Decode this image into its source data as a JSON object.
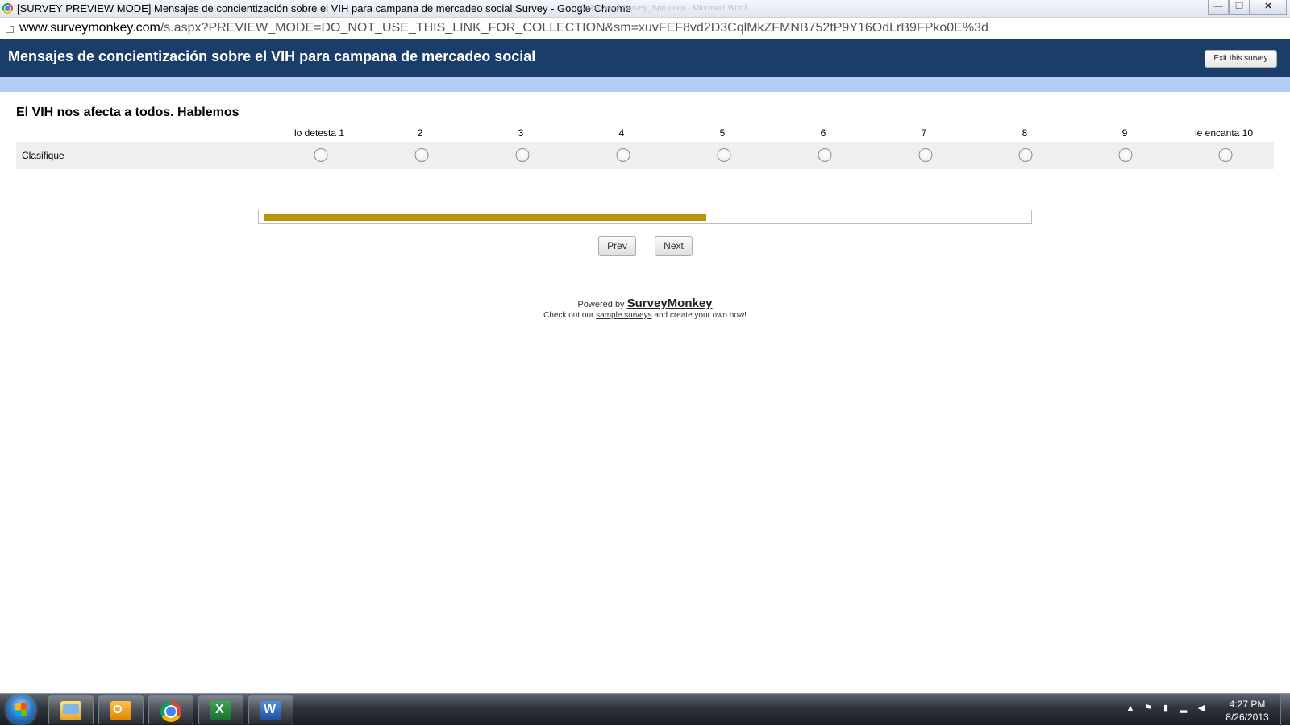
{
  "window": {
    "title": "[SURVEY PREVIEW MODE] Mensajes de concientización sobre el VIH para campana de mercadeo social Survey - Google Chrome",
    "ghost_text": "Web-based Survey_Spn.docx - Microsoft Word",
    "minimize": "—",
    "maximize": "❐",
    "close": "✕"
  },
  "address": {
    "host": "www.surveymonkey.com",
    "path": "/s.aspx?PREVIEW_MODE=DO_NOT_USE_THIS_LINK_FOR_COLLECTION&sm=xuvFEF8vd2D3CqlMkZFMNB752tP9Y16OdLrB9FPko0E%3d"
  },
  "survey": {
    "title": "Mensajes de concientización sobre el VIH para campana de mercadeo social",
    "exit_label": "Exit this survey",
    "header_color": "#1a3d6a",
    "strip_color": "#b5cdf3"
  },
  "question": {
    "title": "El VIH nos afecta a todos. Hablemos",
    "row_label": "Clasifique",
    "scale": [
      "lo detesta 1",
      "2",
      "3",
      "4",
      "5",
      "6",
      "7",
      "8",
      "9",
      "le encanta 10"
    ],
    "selected": null
  },
  "progress": {
    "percent": 58,
    "fill_color": "#b8940a"
  },
  "nav": {
    "prev": "Prev",
    "next": "Next"
  },
  "footer": {
    "powered_prefix": "Powered by",
    "brand": "SurveyMonkey",
    "checkout_prefix": "Check out our",
    "sample_link": "sample surveys",
    "checkout_suffix": "and create your own now!"
  },
  "taskbar": {
    "apps": [
      "windows-explorer-icon",
      "outlook-icon",
      "chrome-icon",
      "excel-icon",
      "word-icon"
    ],
    "time": "4:27 PM",
    "date": "8/26/2013"
  }
}
